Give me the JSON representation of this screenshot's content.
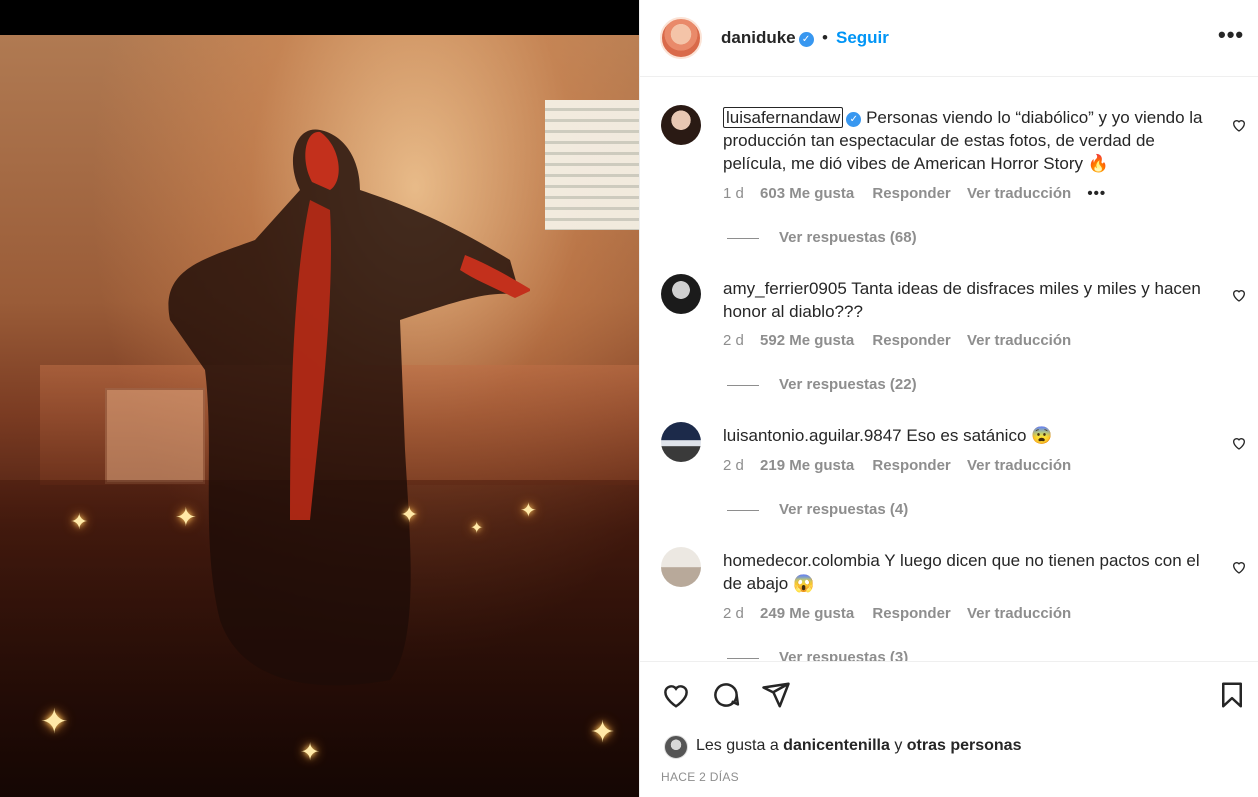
{
  "post": {
    "username": "daniduke",
    "follow_label": "Seguir",
    "separator": "•",
    "more_label": "•••"
  },
  "comments": [
    {
      "username": "luisafernandaw",
      "verified": true,
      "text": "Personas viendo lo “diabólico” y yo viendo la producción tan espectacular de estas fotos, de verdad de película, me dió vibes de American Horror Story 🔥",
      "time": "1 d",
      "likes": "603 Me gusta",
      "reply": "Responder",
      "translate": "Ver traducción",
      "more": "•••",
      "view_replies": "Ver respuestas (68)"
    },
    {
      "username": "amy_ferrier0905",
      "verified": false,
      "text": "Tanta ideas de disfraces miles y miles y hacen honor al diablo???",
      "time": "2 d",
      "likes": "592 Me gusta",
      "reply": "Responder",
      "translate": "Ver traducción",
      "view_replies": "Ver respuestas (22)"
    },
    {
      "username": "luisantonio.aguilar.9847",
      "verified": false,
      "text": "Eso es satánico 😨",
      "time": "2 d",
      "likes": "219 Me gusta",
      "reply": "Responder",
      "translate": "Ver traducción",
      "view_replies": "Ver respuestas (4)"
    },
    {
      "username": "homedecor.colombia",
      "verified": false,
      "text": "Y luego dicen que no tienen pactos con el de abajo 😱",
      "time": "2 d",
      "likes": "249 Me gusta",
      "reply": "Responder",
      "translate": "Ver traducción",
      "view_replies": "Ver respuestas (3)"
    }
  ],
  "footer": {
    "likes_prefix": "Les gusta a ",
    "likes_user": "danicentenilla",
    "likes_middle": " y ",
    "likes_suffix": "otras personas",
    "date": "HACE 2 DÍAS"
  },
  "icons": {
    "heart": "heart-icon",
    "comment": "comment-icon",
    "share": "share-icon",
    "save": "bookmark-icon",
    "verified": "verified-badge-icon"
  },
  "colors": {
    "link": "#0095f6",
    "verified": "#3897f0",
    "muted": "#8e8e8e"
  }
}
